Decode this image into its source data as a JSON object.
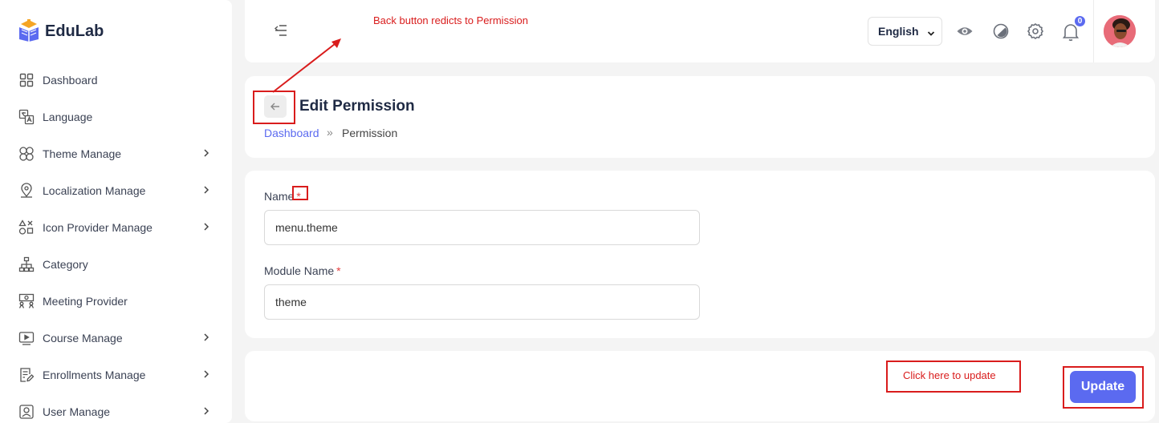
{
  "brand": {
    "name": "EduLab"
  },
  "sidebar": {
    "items": [
      {
        "label": "Dashboard",
        "icon": "dashboard-grid-icon",
        "has_submenu": false
      },
      {
        "label": "Language",
        "icon": "translate-icon",
        "has_submenu": false
      },
      {
        "label": "Theme Manage",
        "icon": "theme-icon",
        "has_submenu": true
      },
      {
        "label": "Localization Manage",
        "icon": "map-pin-icon",
        "has_submenu": true
      },
      {
        "label": "Icon Provider Manage",
        "icon": "shapes-icon",
        "has_submenu": true
      },
      {
        "label": "Category",
        "icon": "hierarchy-icon",
        "has_submenu": false
      },
      {
        "label": "Meeting Provider",
        "icon": "meeting-icon",
        "has_submenu": false
      },
      {
        "label": "Course Manage",
        "icon": "video-play-icon",
        "has_submenu": true
      },
      {
        "label": "Enrollments Manage",
        "icon": "document-edit-icon",
        "has_submenu": true
      },
      {
        "label": "User Manage",
        "icon": "user-icon",
        "has_submenu": true
      }
    ]
  },
  "header": {
    "language": {
      "selected": "English"
    },
    "notifications": {
      "count": "0"
    },
    "icons": [
      "menu-toggle-icon",
      "eye-icon",
      "theme-contrast-icon",
      "gear-icon",
      "bell-icon"
    ]
  },
  "page": {
    "title": "Edit Permission",
    "breadcrumb": {
      "link": "Dashboard",
      "separator": "»",
      "current": "Permission"
    }
  },
  "form": {
    "name": {
      "label": "Name",
      "required_mark": "*",
      "value": "menu.theme"
    },
    "module_name": {
      "label": "Module Name",
      "required_mark": "*",
      "value": "theme"
    },
    "submit_label": "Update"
  },
  "annotations": {
    "back_note": "Back button redicts to Permission",
    "update_note": "Click here to update"
  },
  "colors": {
    "accent": "#5b6af0",
    "annotation": "#d91c1c",
    "background": "#f4f4f4"
  }
}
